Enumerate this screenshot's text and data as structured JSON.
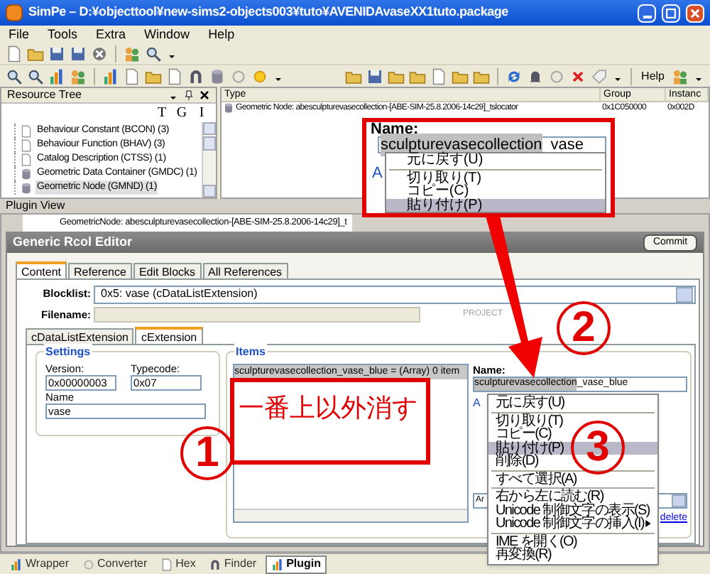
{
  "window": {
    "title": "SimPe – D:¥objecttool¥new-sims2-objects003¥tuto¥AVENIDAvaseXX1tuto.package"
  },
  "menu": [
    "File",
    "Tools",
    "Extra",
    "Window",
    "Help"
  ],
  "toolbar": {
    "help": "Help"
  },
  "resource_tree": {
    "title": "Resource Tree",
    "filters": [
      "T",
      "G",
      "I"
    ],
    "items": [
      {
        "label": "Behaviour Constant (BCON) (3)",
        "kind": "file",
        "selected": false
      },
      {
        "label": "Behaviour Function (BHAV) (3)",
        "kind": "file",
        "selected": false
      },
      {
        "label": "Catalog Description (CTSS) (1)",
        "kind": "file",
        "selected": false
      },
      {
        "label": "Geometric Data Container (GMDC) (1)",
        "kind": "disk",
        "selected": false
      },
      {
        "label": "Geometric Node (GMND) (1)",
        "kind": "disk",
        "selected": true
      }
    ]
  },
  "resource_list": {
    "columns": [
      "Type",
      "Group",
      "Instanc"
    ],
    "rows": [
      {
        "cells": [
          "Geometric Node: abesculpturevasecollection-[ABE-SIM-25.8.2006-14c29]_tslocator",
          "0x1C050000",
          "0x002D"
        ]
      }
    ]
  },
  "plugin_view": {
    "title": "Plugin View",
    "document_tab": "GeometricNode: abesculpturevasecollection-[ABE-SIM-25.8.2006-14c29]_t"
  },
  "editor": {
    "title": "Generic Rcol Editor",
    "commit": "Commit",
    "tabs": [
      {
        "label": "Content",
        "selected": true
      },
      {
        "label": "Reference",
        "selected": false
      },
      {
        "label": "Edit Blocks",
        "selected": false
      },
      {
        "label": "All References",
        "selected": false
      }
    ],
    "blocklist_label": "Blocklist:",
    "blocklist": "0x5: vase (cDataListExtension)",
    "filename_label": "Filename:",
    "filename_hint": "PROJECT",
    "subtabs": [
      {
        "label": "cDataListExtension",
        "selected": false
      },
      {
        "label": "cExtension",
        "selected": true
      }
    ],
    "settings": {
      "title": "Settings",
      "version_label": "Version:",
      "version": "0x00000003",
      "typecode_label": "Typecode:",
      "typecode": "0x07",
      "name_label": "Name",
      "name": "vase"
    },
    "items": {
      "title": "Items",
      "list": [
        {
          "label": "sculpturevasecollection_vase_blue = (Array) 0 item",
          "selected": true
        }
      ],
      "name_label": "Name:",
      "name_selected": "sculpturevasecollection",
      "name_rest": "_vase_blue",
      "group_fragment": "A",
      "combo": "Ar",
      "delete_link": "delete"
    }
  },
  "context_menu": [
    {
      "kind": "item",
      "label": "元に戻す(U)",
      "selected": false
    },
    {
      "kind": "separator"
    },
    {
      "kind": "item",
      "label": "切り取り(T)",
      "selected": false
    },
    {
      "kind": "item",
      "label": "コピー(C)",
      "selected": false
    },
    {
      "kind": "item",
      "label": "貼り付け(P)",
      "selected": true
    },
    {
      "kind": "item",
      "label": "削除(D)",
      "selected": false
    },
    {
      "kind": "separator"
    },
    {
      "kind": "item",
      "label": "すべて選択(A)",
      "selected": false
    },
    {
      "kind": "separator"
    },
    {
      "kind": "item",
      "label": "右から左に読む(R)",
      "selected": false
    },
    {
      "kind": "item",
      "label": "Unicode 制御文字の表示(S)",
      "selected": false
    },
    {
      "kind": "submenu",
      "label": "Unicode 制御文字の挿入(I)",
      "selected": false
    },
    {
      "kind": "separator"
    },
    {
      "kind": "item",
      "label": "IME を開く(O)",
      "selected": false
    },
    {
      "kind": "item",
      "label": "再変換(R)",
      "selected": false
    }
  ],
  "callout": {
    "name_label": "Name:",
    "selected_text": "sculpturevasecollection",
    "rest": "vase",
    "group_fragment": "A",
    "menu": [
      {
        "kind": "item",
        "label": "元に戻す(U)",
        "selected": false
      },
      {
        "kind": "separator"
      },
      {
        "kind": "item",
        "label": "切り取り(T)",
        "selected": false
      },
      {
        "kind": "item",
        "label": "コピー(C)",
        "selected": false
      },
      {
        "kind": "item",
        "label": "貼り付け(P)",
        "selected": true
      }
    ]
  },
  "note": "一番上以外消す",
  "step_markers": [
    "1",
    "2",
    "3"
  ],
  "bottom_tabs": [
    {
      "label": "Wrapper",
      "selected": false
    },
    {
      "label": "Converter",
      "selected": false
    },
    {
      "label": "Hex",
      "selected": false
    },
    {
      "label": "Finder",
      "selected": false
    },
    {
      "label": "Plugin",
      "selected": true
    }
  ]
}
